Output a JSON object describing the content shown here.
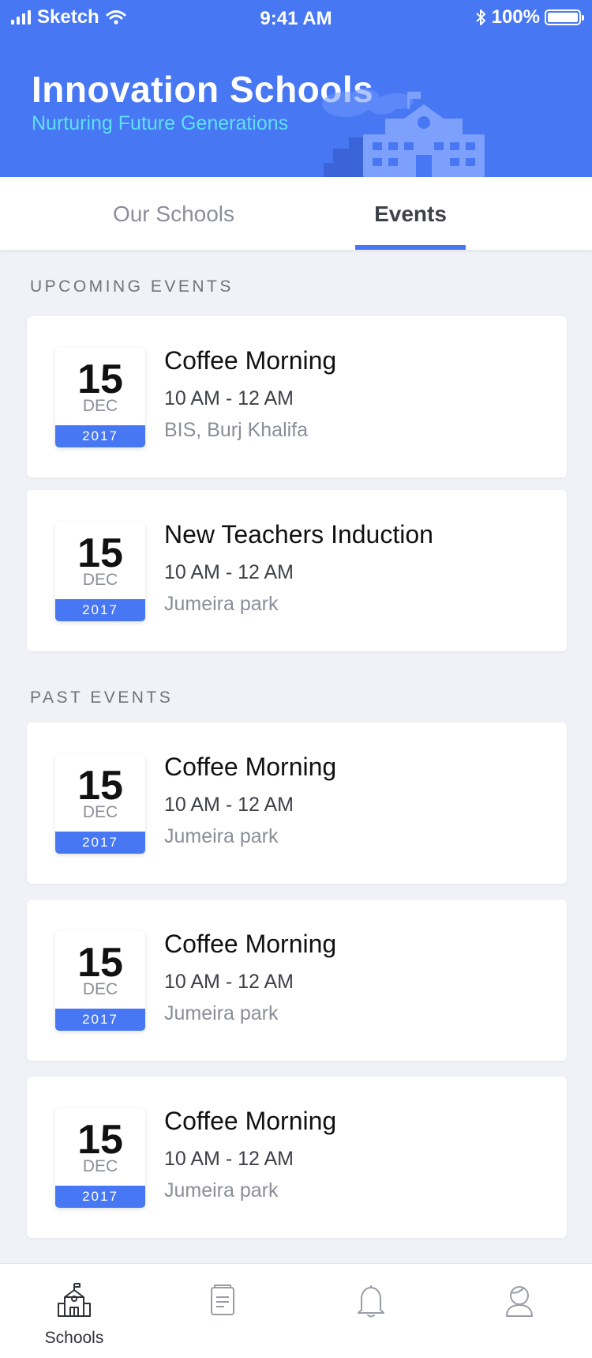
{
  "status_bar": {
    "carrier": "Sketch",
    "time": "9:41 AM",
    "battery": "100%"
  },
  "header": {
    "title": "Innovation Schools",
    "subtitle": "Nurturing Future Generations"
  },
  "tabs": [
    {
      "label": "Our Schools",
      "active": false
    },
    {
      "label": "Events",
      "active": true
    }
  ],
  "upcoming": {
    "title": "UPCOMING EVENTS",
    "events": [
      {
        "day": "15",
        "month": "DEC",
        "year": "2017",
        "title": "Coffee Morning",
        "time": "10 AM - 12 AM",
        "place": "BIS, Burj Khalifa"
      },
      {
        "day": "15",
        "month": "DEC",
        "year": "2017",
        "title": "New Teachers Induction",
        "time": "10 AM - 12 AM",
        "place": "Jumeira park"
      }
    ]
  },
  "past": {
    "title": "PAST EVENTS",
    "events": [
      {
        "day": "15",
        "month": "DEC",
        "year": "2017",
        "title": "Coffee Morning",
        "time": "10 AM - 12 AM",
        "place": "Jumeira park"
      },
      {
        "day": "15",
        "month": "DEC",
        "year": "2017",
        "title": "Coffee Morning",
        "time": "10 AM - 12 AM",
        "place": "Jumeira park"
      },
      {
        "day": "15",
        "month": "DEC",
        "year": "2017",
        "title": "Coffee Morning",
        "time": "10 AM - 12 AM",
        "place": "Jumeira park"
      }
    ]
  },
  "bottom_nav": [
    {
      "label": "Schools",
      "icon": "school-icon",
      "active": true
    },
    {
      "label": "",
      "icon": "document-icon",
      "active": false
    },
    {
      "label": "",
      "icon": "bell-icon",
      "active": false
    },
    {
      "label": "",
      "icon": "profile-icon",
      "active": false
    }
  ],
  "colors": {
    "primary": "#4777f3",
    "accent": "#5ee0f5",
    "background": "#f1f2f8"
  }
}
